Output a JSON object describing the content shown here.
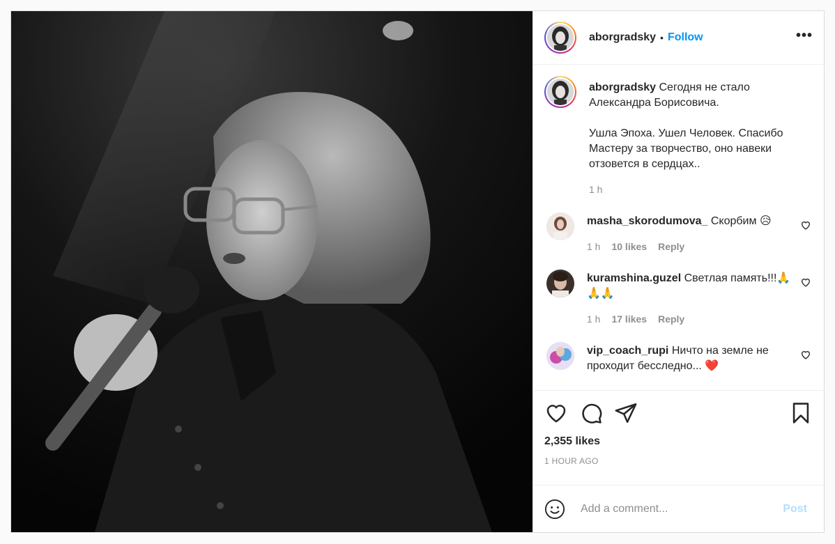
{
  "post": {
    "username": "aborgradsky",
    "dot": "•",
    "follow_label": "Follow",
    "more_label": "•••",
    "photo_icon": "bw-photo-man-with-microphone"
  },
  "caption": {
    "username": "aborgradsky",
    "text": "Сегодня не стало Александра Борисовича.\n\nУшла Эпоха. Ушел Человек. Спасибо Мастеру за творчество, оно навеки отзовется в сердцах..",
    "time": "1 h"
  },
  "comments": [
    {
      "username": "masha_skorodumova_",
      "text": "Скорбим 😥",
      "time": "1 h",
      "likes": "10 likes",
      "reply": "Reply"
    },
    {
      "username": "kuramshina.guzel",
      "text": "Светлая память!!!🙏🙏🙏",
      "time": "1 h",
      "likes": "17 likes",
      "reply": "Reply"
    },
    {
      "username": "vip_coach_rupi",
      "text": "Ничто на земле не проходит бесследно... ❤️"
    }
  ],
  "footer": {
    "likes": "2,355 likes",
    "ago": "1 HOUR AGO",
    "comment_placeholder": "Add a comment...",
    "post_label": "Post"
  }
}
